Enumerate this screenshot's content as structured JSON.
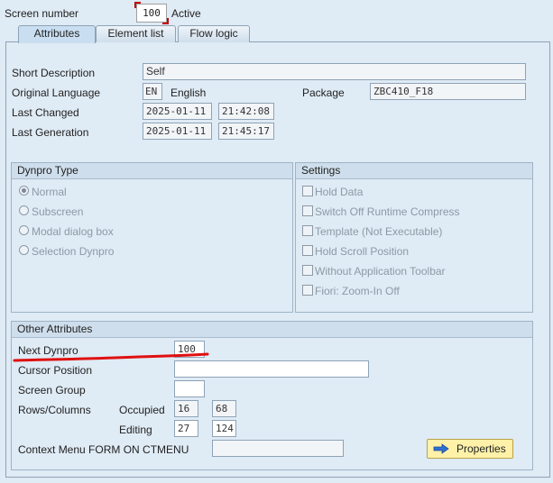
{
  "header": {
    "screen_number_label": "Screen number",
    "screen_number_value": "100",
    "status": "Active"
  },
  "tabs": [
    {
      "label": "Attributes",
      "active": true
    },
    {
      "label": "Element list",
      "active": false
    },
    {
      "label": "Flow logic",
      "active": false
    }
  ],
  "attributes": {
    "short_description_label": "Short Description",
    "short_description_value": "Self",
    "original_language_label": "Original Language",
    "language_code": "EN",
    "language_name": "English",
    "package_label": "Package",
    "package_value": "ZBC410_F18",
    "last_changed_label": "Last Changed",
    "last_changed_date": "2025-01-11",
    "last_changed_time": "21:42:08",
    "last_generation_label": "Last Generation",
    "last_generation_date": "2025-01-11",
    "last_generation_time": "21:45:17"
  },
  "dynpro_type": {
    "title": "Dynpro Type",
    "options": [
      {
        "label": "Normal",
        "selected": true
      },
      {
        "label": "Subscreen",
        "selected": false
      },
      {
        "label": "Modal dialog box",
        "selected": false
      },
      {
        "label": "Selection Dynpro",
        "selected": false
      }
    ]
  },
  "settings": {
    "title": "Settings",
    "options": [
      {
        "label": "Hold Data",
        "checked": false
      },
      {
        "label": "Switch Off Runtime Compress",
        "checked": false
      },
      {
        "label": "Template (Not Executable)",
        "checked": false
      },
      {
        "label": "Hold Scroll Position",
        "checked": false
      },
      {
        "label": "Without Application Toolbar",
        "checked": false
      },
      {
        "label": "Fiori: Zoom-In Off",
        "checked": false
      }
    ]
  },
  "other_attributes": {
    "title": "Other Attributes",
    "next_dynpro_label": "Next Dynpro",
    "next_dynpro_value": "100",
    "cursor_position_label": "Cursor Position",
    "cursor_position_value": "",
    "screen_group_label": "Screen Group",
    "screen_group_value": "",
    "rows_columns_label": "Rows/Columns",
    "occupied_label": "Occupied",
    "occupied_rows": "16",
    "occupied_cols": "68",
    "editing_label": "Editing",
    "editing_rows": "27",
    "editing_cols": "124",
    "context_menu_label": "Context Menu FORM ON CTMENU",
    "context_menu_value": "",
    "properties_button": "Properties"
  },
  "colors": {
    "annotation_underline": "#e01010",
    "properties_button_bg": "#fff1a8",
    "arrow_icon": "#2f6fd1"
  },
  "icons": {
    "properties_icon": "arrow-right-icon"
  }
}
